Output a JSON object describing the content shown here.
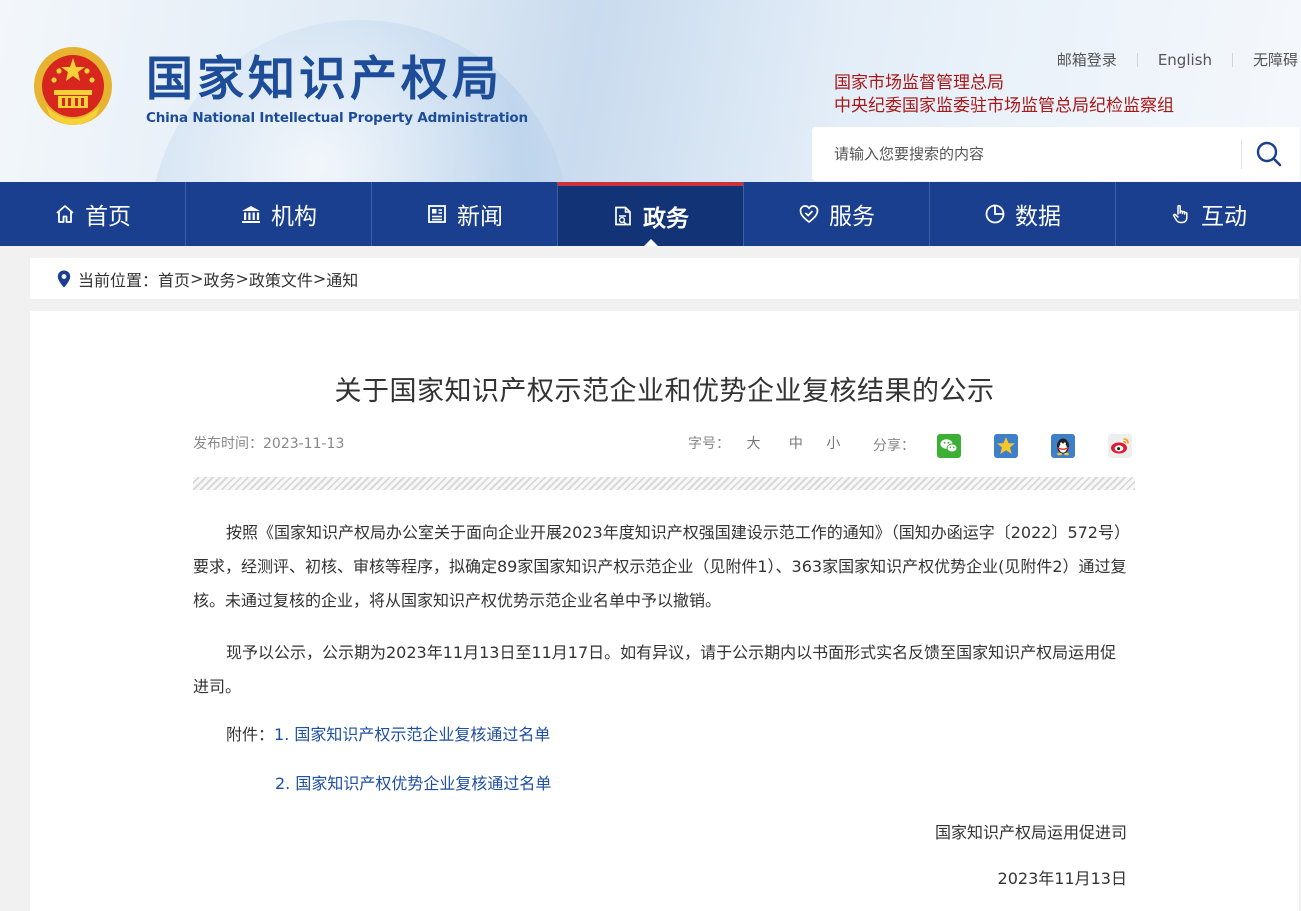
{
  "header": {
    "logo_cn": "国家知识产权局",
    "logo_en": "China National Intellectual Property Administration",
    "top_links": [
      "邮箱登录",
      "English",
      "无障碍"
    ],
    "red_links": [
      "国家市场监督管理总局",
      "中央纪委国家监委驻市场监管总局纪检监察组"
    ],
    "search": {
      "placeholder": "请输入您要搜索的内容"
    }
  },
  "nav": {
    "items": [
      {
        "label": "首页",
        "icon": "home-icon"
      },
      {
        "label": "机构",
        "icon": "institution-icon"
      },
      {
        "label": "新闻",
        "icon": "news-icon"
      },
      {
        "label": "政务",
        "icon": "document-icon",
        "active": true
      },
      {
        "label": "服务",
        "icon": "service-icon"
      },
      {
        "label": "数据",
        "icon": "pie-chart-icon"
      },
      {
        "label": "互动",
        "icon": "hand-pointer-icon"
      }
    ]
  },
  "breadcrumb": {
    "prefix": "当前位置：",
    "items": [
      "首页",
      ">",
      "政务",
      ">",
      "政策文件",
      ">",
      "通知"
    ]
  },
  "article": {
    "title": "关于国家知识产权示范企业和优势企业复核结果的公示",
    "publish_label": "发布时间：",
    "publish_date": "2023-11-13",
    "font_size_label": "字号：",
    "font_sizes": [
      "大",
      "中",
      "小"
    ],
    "share_label": "分享：",
    "share_icons": [
      "wechat-icon",
      "qzone-icon",
      "qq-icon",
      "weibo-icon"
    ],
    "para1": "按照《国家知识产权局办公室关于面向企业开展2023年度知识产权强国建设示范工作的通知》（国知办函运字〔2022〕572号）要求，经测评、初核、审核等程序，拟确定89家国家知识产权示范企业（见附件1）、363家国家知识产权优势企业(见附件2）通过复核。未通过复核的企业，将从国家知识产权优势示范企业名单中予以撤销。",
    "para2": "现予以公示，公示期为2023年11月13日至11月17日。如有异议，请于公示期内以书面形式实名反馈至国家知识产权局运用促进司。",
    "attachment_label": "附件：",
    "attachments": [
      "1. 国家知识产权示范企业复核通过名单",
      "2. 国家知识产权优势企业复核通过名单"
    ],
    "signature_org": "国家知识产权局运用促进司",
    "signature_date": "2023年11月13日"
  },
  "colors": {
    "brand_blue": "#1d4d98",
    "nav_bg": "#1a3f8e",
    "nav_active_bg": "#123376",
    "nav_active_border": "#c8333c",
    "red_link": "#a81818",
    "attachment_link": "#1e4fa3"
  }
}
